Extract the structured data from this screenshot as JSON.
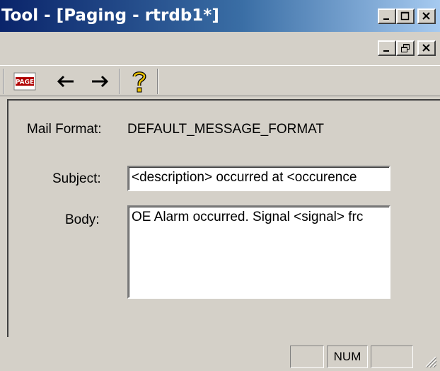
{
  "window": {
    "title": "Tool - [Paging - rtrdb1*]",
    "minimize_label": "_",
    "restore_label": "❐",
    "close_label": "✕"
  },
  "toolbar": {
    "page_icon_text": "PAGE",
    "back_glyph": "←",
    "forward_glyph": "→",
    "help_glyph": "?"
  },
  "form": {
    "mail_format_label": "Mail Format:",
    "mail_format_value": "DEFAULT_MESSAGE_FORMAT",
    "subject_label": "Subject:",
    "subject_value": "<description> occurred at <occurence",
    "body_label": "Body:",
    "body_value": "OE Alarm occurred. Signal <signal> frc"
  },
  "statusbar": {
    "panel1": "",
    "num": "NUM",
    "panel3": ""
  },
  "colors": {
    "title_gradient_start": "#0a246a",
    "title_gradient_end": "#a6caf0",
    "face": "#d4d0c8",
    "help_icon": "#e8c000",
    "page_icon": "#b00000"
  }
}
